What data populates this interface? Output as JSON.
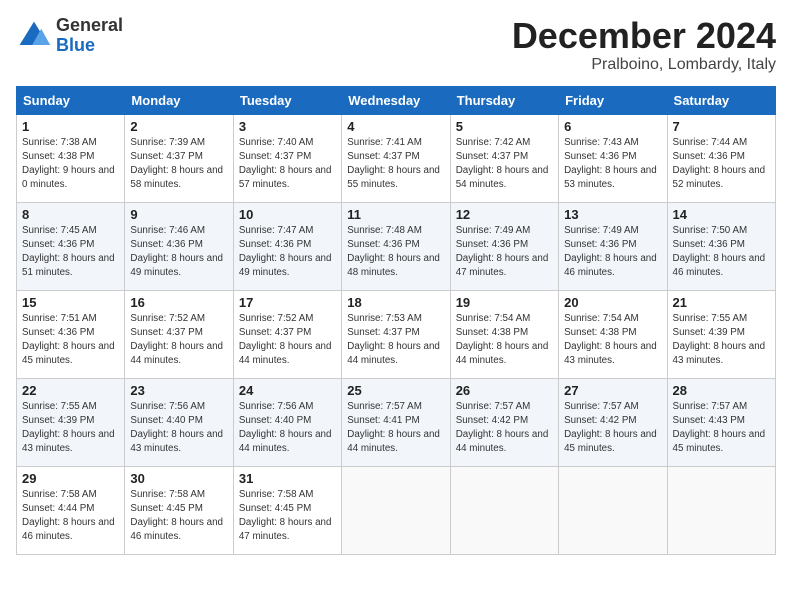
{
  "logo": {
    "general": "General",
    "blue": "Blue"
  },
  "title": "December 2024",
  "location": "Pralboino, Lombardy, Italy",
  "weekdays": [
    "Sunday",
    "Monday",
    "Tuesday",
    "Wednesday",
    "Thursday",
    "Friday",
    "Saturday"
  ],
  "weeks": [
    [
      {
        "day": "1",
        "sunrise": "7:38 AM",
        "sunset": "4:38 PM",
        "daylight": "9 hours and 0 minutes."
      },
      {
        "day": "2",
        "sunrise": "7:39 AM",
        "sunset": "4:37 PM",
        "daylight": "8 hours and 58 minutes."
      },
      {
        "day": "3",
        "sunrise": "7:40 AM",
        "sunset": "4:37 PM",
        "daylight": "8 hours and 57 minutes."
      },
      {
        "day": "4",
        "sunrise": "7:41 AM",
        "sunset": "4:37 PM",
        "daylight": "8 hours and 55 minutes."
      },
      {
        "day": "5",
        "sunrise": "7:42 AM",
        "sunset": "4:37 PM",
        "daylight": "8 hours and 54 minutes."
      },
      {
        "day": "6",
        "sunrise": "7:43 AM",
        "sunset": "4:36 PM",
        "daylight": "8 hours and 53 minutes."
      },
      {
        "day": "7",
        "sunrise": "7:44 AM",
        "sunset": "4:36 PM",
        "daylight": "8 hours and 52 minutes."
      }
    ],
    [
      {
        "day": "8",
        "sunrise": "7:45 AM",
        "sunset": "4:36 PM",
        "daylight": "8 hours and 51 minutes."
      },
      {
        "day": "9",
        "sunrise": "7:46 AM",
        "sunset": "4:36 PM",
        "daylight": "8 hours and 49 minutes."
      },
      {
        "day": "10",
        "sunrise": "7:47 AM",
        "sunset": "4:36 PM",
        "daylight": "8 hours and 49 minutes."
      },
      {
        "day": "11",
        "sunrise": "7:48 AM",
        "sunset": "4:36 PM",
        "daylight": "8 hours and 48 minutes."
      },
      {
        "day": "12",
        "sunrise": "7:49 AM",
        "sunset": "4:36 PM",
        "daylight": "8 hours and 47 minutes."
      },
      {
        "day": "13",
        "sunrise": "7:49 AM",
        "sunset": "4:36 PM",
        "daylight": "8 hours and 46 minutes."
      },
      {
        "day": "14",
        "sunrise": "7:50 AM",
        "sunset": "4:36 PM",
        "daylight": "8 hours and 46 minutes."
      }
    ],
    [
      {
        "day": "15",
        "sunrise": "7:51 AM",
        "sunset": "4:36 PM",
        "daylight": "8 hours and 45 minutes."
      },
      {
        "day": "16",
        "sunrise": "7:52 AM",
        "sunset": "4:37 PM",
        "daylight": "8 hours and 44 minutes."
      },
      {
        "day": "17",
        "sunrise": "7:52 AM",
        "sunset": "4:37 PM",
        "daylight": "8 hours and 44 minutes."
      },
      {
        "day": "18",
        "sunrise": "7:53 AM",
        "sunset": "4:37 PM",
        "daylight": "8 hours and 44 minutes."
      },
      {
        "day": "19",
        "sunrise": "7:54 AM",
        "sunset": "4:38 PM",
        "daylight": "8 hours and 44 minutes."
      },
      {
        "day": "20",
        "sunrise": "7:54 AM",
        "sunset": "4:38 PM",
        "daylight": "8 hours and 43 minutes."
      },
      {
        "day": "21",
        "sunrise": "7:55 AM",
        "sunset": "4:39 PM",
        "daylight": "8 hours and 43 minutes."
      }
    ],
    [
      {
        "day": "22",
        "sunrise": "7:55 AM",
        "sunset": "4:39 PM",
        "daylight": "8 hours and 43 minutes."
      },
      {
        "day": "23",
        "sunrise": "7:56 AM",
        "sunset": "4:40 PM",
        "daylight": "8 hours and 43 minutes."
      },
      {
        "day": "24",
        "sunrise": "7:56 AM",
        "sunset": "4:40 PM",
        "daylight": "8 hours and 44 minutes."
      },
      {
        "day": "25",
        "sunrise": "7:57 AM",
        "sunset": "4:41 PM",
        "daylight": "8 hours and 44 minutes."
      },
      {
        "day": "26",
        "sunrise": "7:57 AM",
        "sunset": "4:42 PM",
        "daylight": "8 hours and 44 minutes."
      },
      {
        "day": "27",
        "sunrise": "7:57 AM",
        "sunset": "4:42 PM",
        "daylight": "8 hours and 45 minutes."
      },
      {
        "day": "28",
        "sunrise": "7:57 AM",
        "sunset": "4:43 PM",
        "daylight": "8 hours and 45 minutes."
      }
    ],
    [
      {
        "day": "29",
        "sunrise": "7:58 AM",
        "sunset": "4:44 PM",
        "daylight": "8 hours and 46 minutes."
      },
      {
        "day": "30",
        "sunrise": "7:58 AM",
        "sunset": "4:45 PM",
        "daylight": "8 hours and 46 minutes."
      },
      {
        "day": "31",
        "sunrise": "7:58 AM",
        "sunset": "4:45 PM",
        "daylight": "8 hours and 47 minutes."
      },
      null,
      null,
      null,
      null
    ]
  ]
}
